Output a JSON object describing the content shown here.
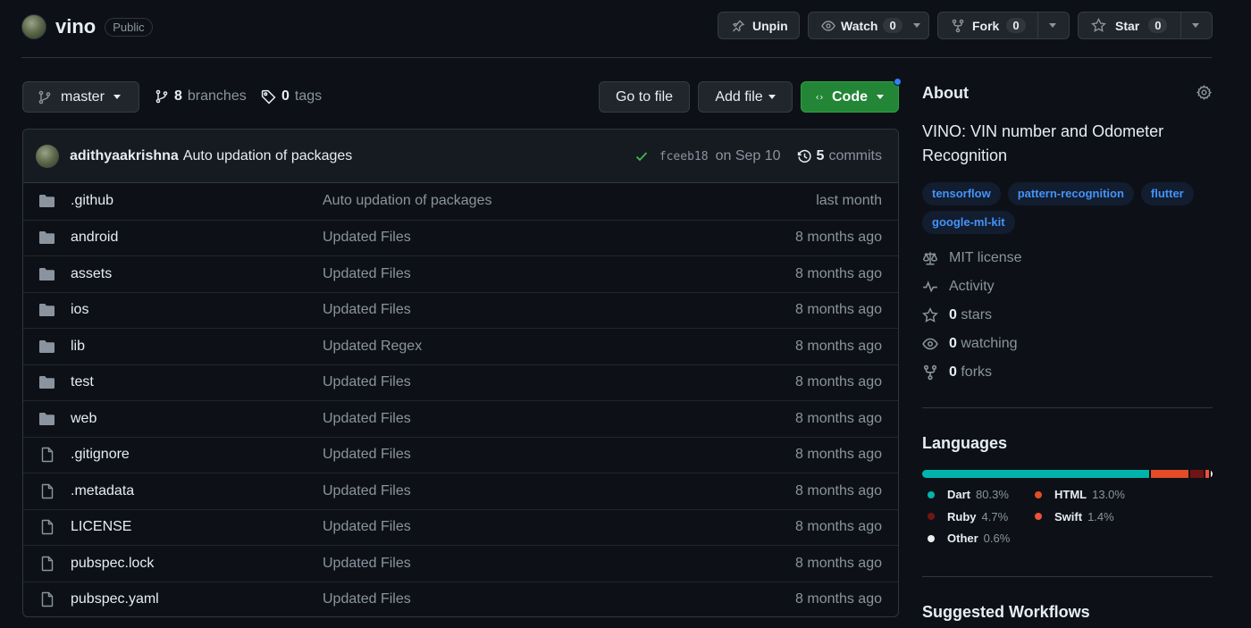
{
  "repo": {
    "name": "vino",
    "visibility": "Public"
  },
  "actions": {
    "unpin": "Unpin",
    "watch": "Watch",
    "watch_count": "0",
    "fork": "Fork",
    "fork_count": "0",
    "star": "Star",
    "star_count": "0"
  },
  "toolbar": {
    "branch": "master",
    "branches_count": "8",
    "branches_label": "branches",
    "tags_count": "0",
    "tags_label": "tags",
    "go_to_file": "Go to file",
    "add_file": "Add file",
    "code": "Code"
  },
  "latest_commit": {
    "author": "adithyaakrishna",
    "message": "Auto updation of packages",
    "sha": "fceeb18",
    "date": "on Sep 10",
    "commits_count": "5",
    "commits_label": "commits"
  },
  "files": [
    {
      "name": ".github",
      "type": "dir",
      "message": "Auto updation of packages",
      "date": "last month"
    },
    {
      "name": "android",
      "type": "dir",
      "message": "Updated Files",
      "date": "8 months ago"
    },
    {
      "name": "assets",
      "type": "dir",
      "message": "Updated Files",
      "date": "8 months ago"
    },
    {
      "name": "ios",
      "type": "dir",
      "message": "Updated Files",
      "date": "8 months ago"
    },
    {
      "name": "lib",
      "type": "dir",
      "message": "Updated Regex",
      "date": "8 months ago"
    },
    {
      "name": "test",
      "type": "dir",
      "message": "Updated Files",
      "date": "8 months ago"
    },
    {
      "name": "web",
      "type": "dir",
      "message": "Updated Files",
      "date": "8 months ago"
    },
    {
      "name": ".gitignore",
      "type": "file",
      "message": "Updated Files",
      "date": "8 months ago"
    },
    {
      "name": ".metadata",
      "type": "file",
      "message": "Updated Files",
      "date": "8 months ago"
    },
    {
      "name": "LICENSE",
      "type": "file",
      "message": "Updated Files",
      "date": "8 months ago"
    },
    {
      "name": "pubspec.lock",
      "type": "file",
      "message": "Updated Files",
      "date": "8 months ago"
    },
    {
      "name": "pubspec.yaml",
      "type": "file",
      "message": "Updated Files",
      "date": "8 months ago"
    }
  ],
  "about": {
    "title": "About",
    "description": "VINO: VIN number and Odometer Recognition",
    "topics": [
      "tensorflow",
      "pattern-recognition",
      "flutter",
      "google-ml-kit"
    ],
    "license": "MIT license",
    "activity": "Activity",
    "stars_count": "0",
    "stars_label": "stars",
    "watching_count": "0",
    "watching_label": "watching",
    "forks_count": "0",
    "forks_label": "forks"
  },
  "languages": {
    "title": "Languages",
    "items": [
      {
        "name": "Dart",
        "percent": "80.3%",
        "value": 80.3,
        "color": "#00B4AB"
      },
      {
        "name": "HTML",
        "percent": "13.0%",
        "value": 13.0,
        "color": "#e34c26"
      },
      {
        "name": "Ruby",
        "percent": "4.7%",
        "value": 4.7,
        "color": "#701516"
      },
      {
        "name": "Swift",
        "percent": "1.4%",
        "value": 1.4,
        "color": "#F05138"
      },
      {
        "name": "Other",
        "percent": "0.6%",
        "value": 0.6,
        "color": "#ededed"
      }
    ]
  },
  "suggested_workflows": {
    "title": "Suggested Workflows"
  },
  "colors": {
    "accent_green": "#238636",
    "link_blue": "#4493f8",
    "background": "#0d1117"
  }
}
